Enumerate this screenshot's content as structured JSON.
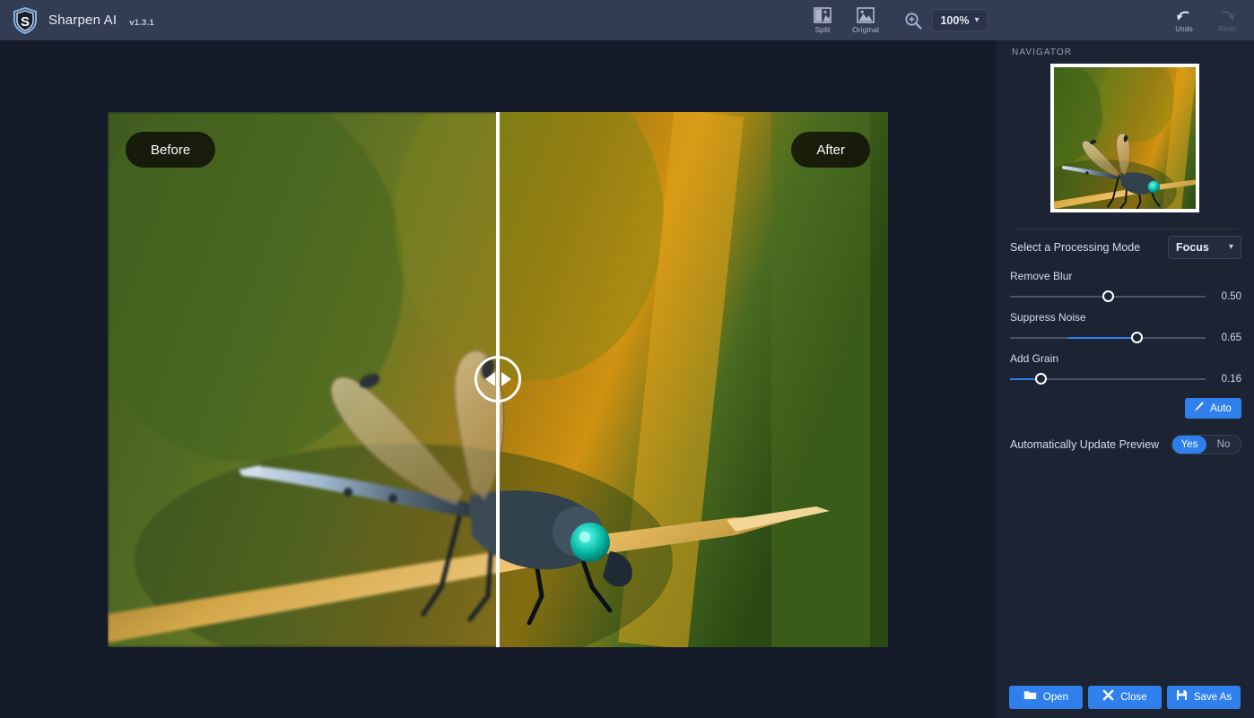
{
  "app": {
    "name": "Sharpen AI",
    "version": "v1.3.1",
    "logo_icon": "shield-s-logo-icon"
  },
  "header": {
    "tools": [
      {
        "label": "Split",
        "icon": "split-view-icon"
      },
      {
        "label": "Original",
        "icon": "original-view-icon"
      }
    ],
    "zoom": {
      "icon": "magnifier-plus-icon",
      "value": "100%",
      "chevron": "chevron-down-icon"
    },
    "history": [
      {
        "label": "Undo",
        "icon": "undo-arrow-icon",
        "enabled": true
      },
      {
        "label": "Redo",
        "icon": "redo-arrow-icon",
        "enabled": false
      }
    ]
  },
  "canvas": {
    "before_label": "Before",
    "after_label": "After",
    "split_handle_icon": "split-drag-handle-icon"
  },
  "panel": {
    "navigator_label": "NAVIGATOR",
    "navigator_thumb": "image-thumbnail-dragonfly",
    "mode": {
      "label": "Select a Processing Mode",
      "value": "Focus",
      "chevron": "chevron-down-icon"
    },
    "sliders": [
      {
        "name": "Remove Blur",
        "value": "0.50",
        "fraction": 0.5,
        "fill_from": 0.5
      },
      {
        "name": "Suppress Noise",
        "value": "0.65",
        "fraction": 0.65,
        "fill_from": 0.3
      },
      {
        "name": "Add Grain",
        "value": "0.16",
        "fraction": 0.16,
        "fill_from": 0.0
      }
    ],
    "auto_button": {
      "label": "Auto",
      "icon": "magic-wand-icon"
    },
    "preview": {
      "label": "Automatically Update Preview",
      "options": [
        "Yes",
        "No"
      ],
      "selected": "Yes"
    }
  },
  "footer": {
    "buttons": [
      {
        "label": "Open",
        "icon": "folder-icon"
      },
      {
        "label": "Close",
        "icon": "close-x-icon"
      },
      {
        "label": "Save As",
        "icon": "floppy-save-icon"
      }
    ]
  },
  "colors": {
    "accent": "#2f80ed",
    "header_bg": "#323c52",
    "panel_bg": "#1c2434",
    "stage_bg": "#141a28"
  }
}
